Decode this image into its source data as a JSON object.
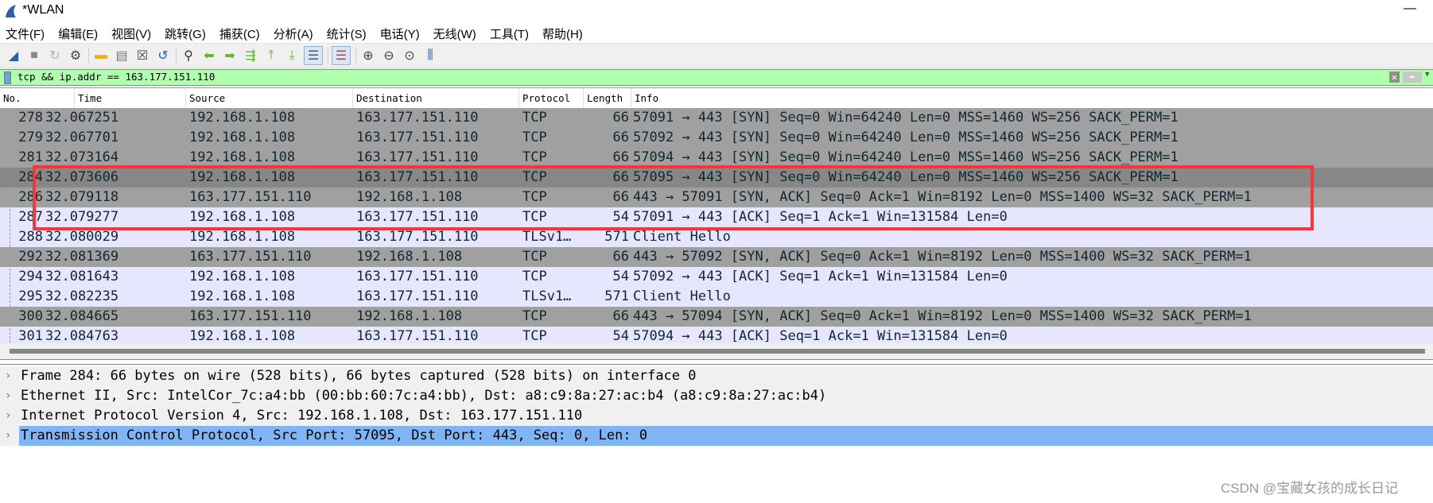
{
  "window": {
    "title": "*WLAN",
    "minimize_label": "—"
  },
  "menu": [
    "文件(F)",
    "编辑(E)",
    "视图(V)",
    "跳转(G)",
    "捕获(C)",
    "分析(A)",
    "统计(S)",
    "电话(Y)",
    "无线(W)",
    "工具(T)",
    "帮助(H)"
  ],
  "toolbar": [
    {
      "name": "start-capture-icon",
      "glyph": "◢",
      "color": "#2a5fb0"
    },
    {
      "name": "stop-capture-icon",
      "glyph": "■",
      "color": "#8a8a8a"
    },
    {
      "name": "restart-capture-icon",
      "glyph": "↻",
      "color": "#b0b0b0"
    },
    {
      "name": "capture-options-icon",
      "glyph": "⚙",
      "color": "#444"
    },
    {
      "name": "sep"
    },
    {
      "name": "open-file-icon",
      "glyph": "▬",
      "color": "#f0b400"
    },
    {
      "name": "save-file-icon",
      "glyph": "▤",
      "color": "#777"
    },
    {
      "name": "close-file-icon",
      "glyph": "☒",
      "color": "#444"
    },
    {
      "name": "reload-file-icon",
      "glyph": "↺",
      "color": "#2a5fb0"
    },
    {
      "name": "sep"
    },
    {
      "name": "find-packet-icon",
      "glyph": "⚲",
      "color": "#333"
    },
    {
      "name": "go-back-icon",
      "glyph": "⬅",
      "color": "#5cb82e"
    },
    {
      "name": "go-forward-icon",
      "glyph": "➡",
      "color": "#5cb82e"
    },
    {
      "name": "go-to-packet-icon",
      "glyph": "⇶",
      "color": "#5cb82e"
    },
    {
      "name": "first-packet-icon",
      "glyph": "⤒",
      "color": "#5cb82e"
    },
    {
      "name": "last-packet-icon",
      "glyph": "⤓",
      "color": "#5cb82e"
    },
    {
      "name": "autoscroll-icon",
      "glyph": "☰",
      "color": "#555",
      "active": true
    },
    {
      "name": "sep"
    },
    {
      "name": "colorize-icon",
      "glyph": "☰",
      "color": "#c04040",
      "active": true
    },
    {
      "name": "sep"
    },
    {
      "name": "zoom-in-icon",
      "glyph": "⊕",
      "color": "#444"
    },
    {
      "name": "zoom-out-icon",
      "glyph": "⊖",
      "color": "#444"
    },
    {
      "name": "zoom-normal-icon",
      "glyph": "⊙",
      "color": "#444"
    },
    {
      "name": "resize-columns-icon",
      "glyph": "⫼",
      "color": "#2a5fb0"
    }
  ],
  "filter": {
    "value": "tcp && ip.addr == 163.177.151.110",
    "clear_icon": "clear-icon",
    "apply_icon": "arrow-right-icon"
  },
  "columns": [
    "No.",
    "Time",
    "Source",
    "Destination",
    "Protocol",
    "Length",
    "Info"
  ],
  "colors": {
    "tcp_syn_gray": "#a0a0a0",
    "current_dim": "#878787",
    "normal_lavender": "#e7e6ff",
    "detail_selected": "#7fb5f5",
    "highlight_box": "#ff3333",
    "filter_valid": "#afffaf"
  },
  "packets": [
    {
      "no": "278",
      "time": "32.067251",
      "src": "192.168.1.108",
      "dst": "163.177.151.110",
      "proto": "TCP",
      "len": "66",
      "info": "57091 → 443 [SYN] Seq=0 Win=64240 Len=0 MSS=1460 WS=256 SACK_PERM=1",
      "style": "gray"
    },
    {
      "no": "279",
      "time": "32.067701",
      "src": "192.168.1.108",
      "dst": "163.177.151.110",
      "proto": "TCP",
      "len": "66",
      "info": "57092 → 443 [SYN] Seq=0 Win=64240 Len=0 MSS=1460 WS=256 SACK_PERM=1",
      "style": "gray"
    },
    {
      "no": "281",
      "time": "32.073164",
      "src": "192.168.1.108",
      "dst": "163.177.151.110",
      "proto": "TCP",
      "len": "66",
      "info": "57094 → 443 [SYN] Seq=0 Win=64240 Len=0 MSS=1460 WS=256 SACK_PERM=1",
      "style": "gray"
    },
    {
      "no": "284",
      "time": "32.073606",
      "src": "192.168.1.108",
      "dst": "163.177.151.110",
      "proto": "TCP",
      "len": "66",
      "info": "57095 → 443 [SYN] Seq=0 Win=64240 Len=0 MSS=1460 WS=256 SACK_PERM=1",
      "style": "selected"
    },
    {
      "no": "286",
      "time": "32.079118",
      "src": "163.177.151.110",
      "dst": "192.168.1.108",
      "proto": "TCP",
      "len": "66",
      "info": "443 → 57091 [SYN, ACK] Seq=0 Ack=1 Win=8192 Len=0 MSS=1400 WS=32 SACK_PERM=1",
      "style": "gray"
    },
    {
      "no": "287",
      "time": "32.079277",
      "src": "192.168.1.108",
      "dst": "163.177.151.110",
      "proto": "TCP",
      "len": "54",
      "info": "57091 → 443 [ACK] Seq=1 Ack=1 Win=131584 Len=0",
      "style": "normal"
    },
    {
      "no": "288",
      "time": "32.080029",
      "src": "192.168.1.108",
      "dst": "163.177.151.110",
      "proto": "TLSv1…",
      "len": "571",
      "info": "Client Hello",
      "style": "normal"
    },
    {
      "no": "292",
      "time": "32.081369",
      "src": "163.177.151.110",
      "dst": "192.168.1.108",
      "proto": "TCP",
      "len": "66",
      "info": "443 → 57092 [SYN, ACK] Seq=0 Ack=1 Win=8192 Len=0 MSS=1400 WS=32 SACK_PERM=1",
      "style": "gray"
    },
    {
      "no": "294",
      "time": "32.081643",
      "src": "192.168.1.108",
      "dst": "163.177.151.110",
      "proto": "TCP",
      "len": "54",
      "info": "57092 → 443 [ACK] Seq=1 Ack=1 Win=131584 Len=0",
      "style": "normal"
    },
    {
      "no": "295",
      "time": "32.082235",
      "src": "192.168.1.108",
      "dst": "163.177.151.110",
      "proto": "TLSv1…",
      "len": "571",
      "info": "Client Hello",
      "style": "normal"
    },
    {
      "no": "300",
      "time": "32.084665",
      "src": "163.177.151.110",
      "dst": "192.168.1.108",
      "proto": "TCP",
      "len": "66",
      "info": "443 → 57094 [SYN, ACK] Seq=0 Ack=1 Win=8192 Len=0 MSS=1400 WS=32 SACK_PERM=1",
      "style": "gray"
    },
    {
      "no": "301",
      "time": "32.084763",
      "src": "192.168.1.108",
      "dst": "163.177.151.110",
      "proto": "TCP",
      "len": "54",
      "info": "57094 → 443 [ACK] Seq=1 Ack=1 Win=131584 Len=0",
      "style": "normal"
    }
  ],
  "details": [
    {
      "text": "Frame 284: 66 bytes on wire (528 bits), 66 bytes captured (528 bits) on interface 0",
      "selected": false
    },
    {
      "text": "Ethernet II, Src: IntelCor_7c:a4:bb (00:bb:60:7c:a4:bb), Dst: a8:c9:8a:27:ac:b4 (a8:c9:8a:27:ac:b4)",
      "selected": false
    },
    {
      "text": "Internet Protocol Version 4, Src: 192.168.1.108, Dst: 163.177.151.110",
      "selected": false
    },
    {
      "text": "Transmission Control Protocol, Src Port: 57095, Dst Port: 443, Seq: 0, Len: 0",
      "selected": true
    }
  ],
  "watermark": "CSDN @宝藏女孩的成长日记"
}
